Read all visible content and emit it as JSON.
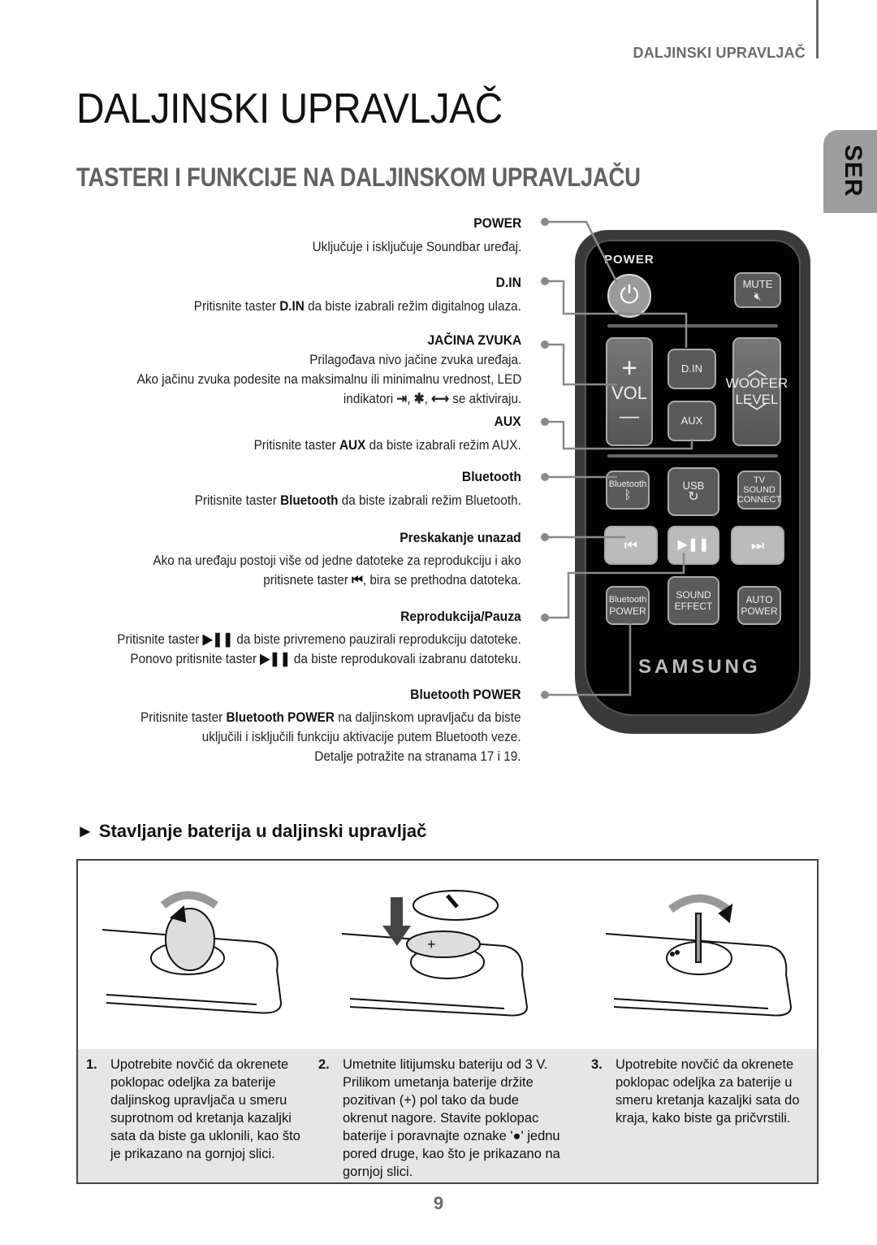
{
  "header": {
    "running_head": "DALJINSKI UPRAVLJAČ",
    "language_tab": "SER"
  },
  "page_title": "DALJINSKI UPRAVLJAČ",
  "section_title": "TASTERI I FUNKCIJE NA DALJINSKOM UPRAVLJAČU",
  "functions": [
    {
      "title": "POWER",
      "lines": [
        "Uključuje i isključuje Soundbar uređaj."
      ]
    },
    {
      "title": "D.IN",
      "pre": "Pritisnite taster ",
      "bold": "D.IN",
      "post": " da biste izabrali režim digitalnog ulaza."
    },
    {
      "title": "JAČINA ZVUKA",
      "lines": [
        "Prilagođava nivo jačine zvuka uređaja.",
        "Ako jačinu zvuka podesite na maksimalnu ili minimalnu vrednost, LED"
      ],
      "indicator_pre": "indikatori",
      "indicator_post": "se aktiviraju.",
      "indicator_icons": [
        "input-source-icon",
        "bluetooth-icon",
        "usb-icon"
      ]
    },
    {
      "title": "AUX",
      "pre": "Pritisnite taster ",
      "bold": "AUX",
      "post": " da biste izabrali režim AUX."
    },
    {
      "title": "Bluetooth",
      "pre": "Pritisnite taster ",
      "bold": "Bluetooth",
      "post": " da biste izabrali režim Bluetooth."
    },
    {
      "title": "Preskakanje unazad",
      "lines": [
        "Ako na uređaju postoji više od jedne datoteke za reprodukciju i ako"
      ],
      "line2_pre": "pritisnete taster ",
      "line2_glyph": "⏮",
      "line2_post": ", bira se prethodna datoteka."
    },
    {
      "title": "Reprodukcija/Pauza",
      "l1_pre": "Pritisnite taster ",
      "glyph": "▶❚❚",
      "l1_post": " da biste privremeno pauzirali reprodukciju datoteke.",
      "l2_pre": "Ponovo pritisnite taster ",
      "l2_post": " da biste reprodukovali izabranu datoteku."
    },
    {
      "title": "Bluetooth POWER",
      "pre": "Pritisnite taster ",
      "bold": "Bluetooth POWER",
      "post": " na daljinskom upravljaču da biste",
      "lines": [
        "uključili i isključili funkciju aktivacije putem Bluetooth veze.",
        "Detalje potražite na stranama 17 i 19."
      ]
    }
  ],
  "remote": {
    "power_label": "POWER",
    "mute_label": "MUTE",
    "din_label": "D.IN",
    "aux_label": "AUX",
    "vol_plus": "+",
    "vol_label": "VOL",
    "vol_minus": "—",
    "woofer_line1": "WOOFER",
    "woofer_line2": "LEVEL",
    "bluetooth_label": "Bluetooth",
    "usb_label": "USB",
    "tv_sound_line1": "TV SOUND",
    "tv_sound_line2": "CONNECT",
    "prev_glyph": "⏮",
    "play_pause_glyph": "▶❚❚",
    "next_glyph": "⏭",
    "bt_power_line1": "Bluetooth",
    "bt_power_line2": "POWER",
    "sound_effect_line1": "SOUND",
    "sound_effect_line2": "EFFECT",
    "auto_power_line1": "AUTO",
    "auto_power_line2": "POWER",
    "brand": "SAMSUNG"
  },
  "battery": {
    "heading_marker": "►",
    "heading": "Stavljanje baterija u daljinski upravljač",
    "steps": [
      {
        "num": "1.",
        "text": "Upotrebite novčić da okrenete poklopac odeljka za baterije daljinskog upravljača u smeru suprotnom od kretanja kazaljki sata da biste ga uklonili, kao što je prikazano na gornjoj slici."
      },
      {
        "num": "2.",
        "text": "Umetnite litijumsku bateriju od 3 V. Prilikom umetanja baterije držite pozitivan (+) pol tako da bude okrenut nagore. Stavite poklopac baterije i poravnajte oznake '●' jednu pored druge, kao što je prikazano na gornjoj slici."
      },
      {
        "num": "3.",
        "text": "Upotrebite novčić da okrenete poklopac odeljka za baterije u smeru kretanja kazaljki sata do kraja, kako biste ga pričvrstili."
      }
    ]
  },
  "page_number": "9"
}
